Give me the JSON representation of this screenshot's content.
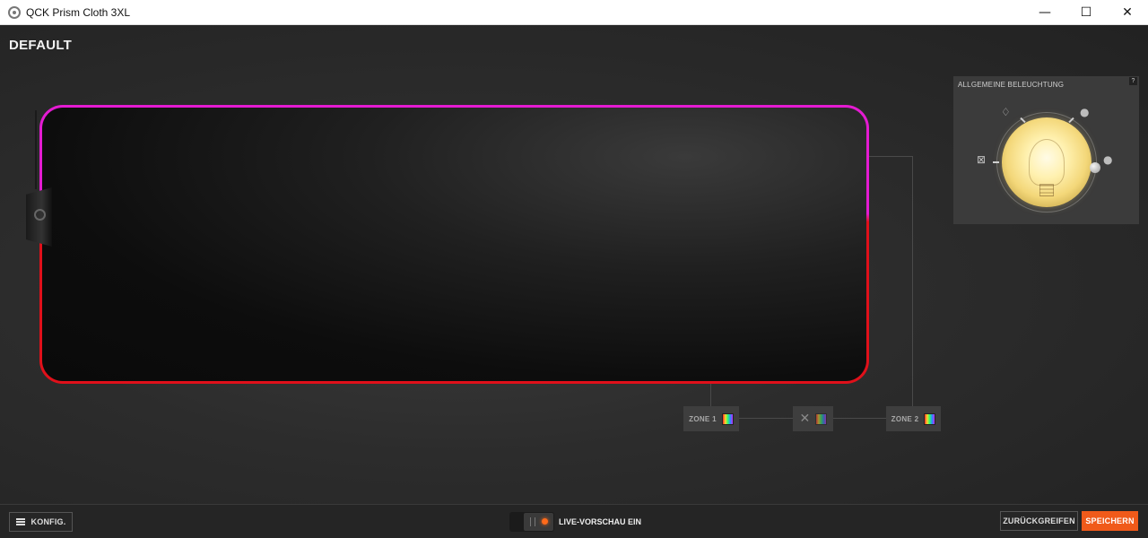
{
  "window": {
    "title": "QCK Prism Cloth 3XL",
    "controls": {
      "minimize": "—",
      "maximize": "☐",
      "close": "✕"
    }
  },
  "profile": {
    "name": "DEFAULT"
  },
  "zones": [
    {
      "label": "ZONE 1",
      "icon": "color-swatch-icon"
    },
    {
      "label": "",
      "icon": "unlink-x-icon"
    },
    {
      "label": "ZONE 2",
      "icon": "color-swatch-icon"
    }
  ],
  "lighting_panel": {
    "title": "ALLGEMEINE BELEUCHTUNG",
    "help": "?",
    "brightness_icon": "light-bulb-icon"
  },
  "pad_colors": {
    "top": "#e41bd2",
    "bottom": "#e0101a"
  },
  "bottom_bar": {
    "config_label": "KONFIG.",
    "live_preview_label": "LIVE-VORSCHAU EIN",
    "revert_label": "ZURÜCKGREIFEN",
    "save_label": "SPEICHERN"
  },
  "colors": {
    "accent": "#f05a1a",
    "live_indicator": "#ff6a1a"
  }
}
